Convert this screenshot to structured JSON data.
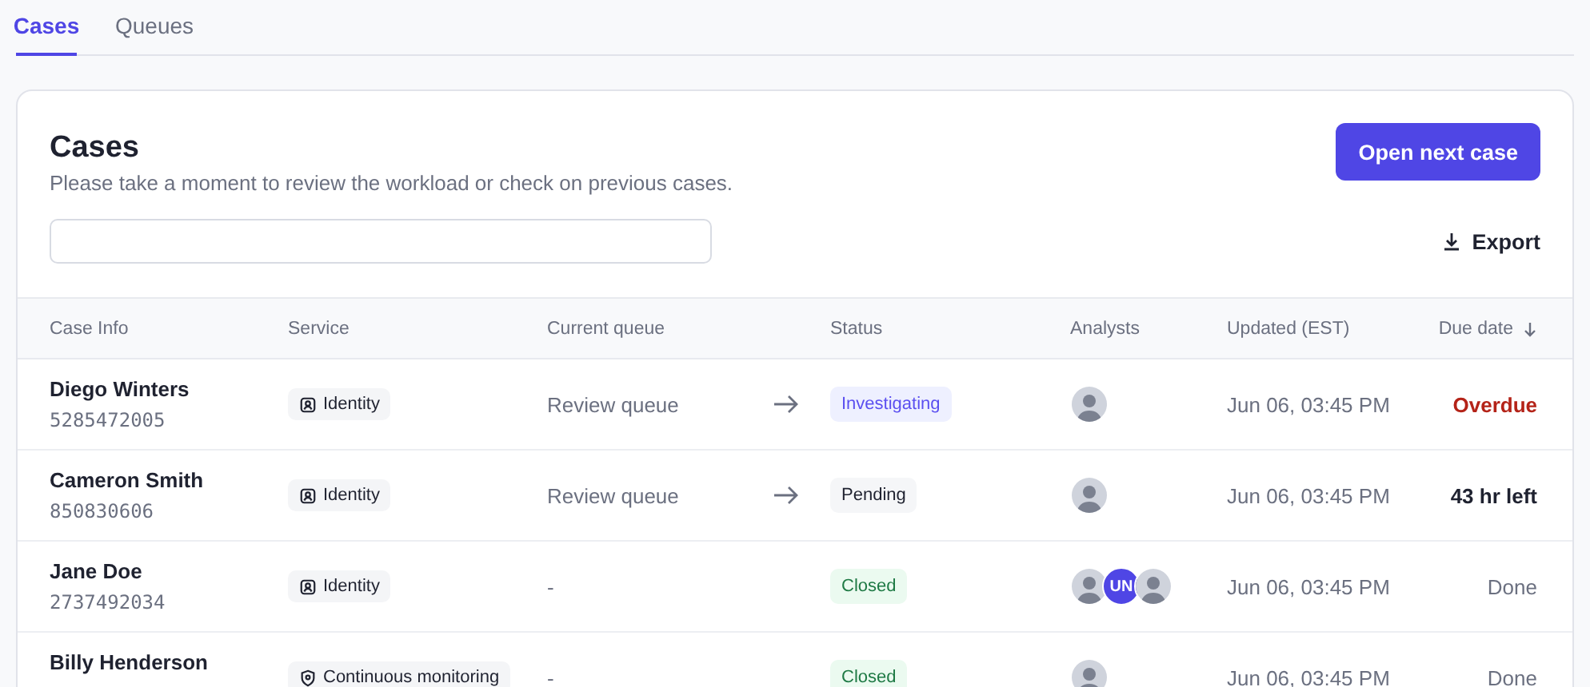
{
  "tabs": [
    {
      "label": "Cases",
      "selected": true
    },
    {
      "label": "Queues",
      "selected": false
    }
  ],
  "header": {
    "title": "Cases",
    "subtitle": "Please take a moment to review the workload or check on previous cases.",
    "primary_button": "Open next case",
    "export_button": "Export"
  },
  "table": {
    "columns": [
      "Case Info",
      "Service",
      "Current queue",
      "",
      "Status",
      "Analysts",
      "Updated (EST)",
      "Due date"
    ],
    "rows": [
      {
        "name": "Diego Winters",
        "id": "5285472005",
        "service": {
          "kind": "identity",
          "label": "Identity"
        },
        "queue": "Review queue",
        "has_arrow": true,
        "status": {
          "kind": "investigating",
          "label": "Investigating"
        },
        "analysts": [
          {
            "kind": "photo"
          }
        ],
        "updated": "Jun 06, 03:45 PM",
        "due": {
          "kind": "overdue",
          "label": "Overdue"
        }
      },
      {
        "name": "Cameron Smith",
        "id": "850830606",
        "service": {
          "kind": "identity",
          "label": "Identity"
        },
        "queue": "Review queue",
        "has_arrow": true,
        "status": {
          "kind": "pending",
          "label": "Pending"
        },
        "analysts": [
          {
            "kind": "photo"
          }
        ],
        "updated": "Jun 06, 03:45 PM",
        "due": {
          "kind": "remaining",
          "label": "43 hr left"
        }
      },
      {
        "name": "Jane Doe",
        "id": "2737492034",
        "service": {
          "kind": "identity",
          "label": "Identity"
        },
        "queue": "-",
        "has_arrow": false,
        "status": {
          "kind": "closed",
          "label": "Closed"
        },
        "analysts": [
          {
            "kind": "photo"
          },
          {
            "kind": "initials",
            "label": "UN"
          },
          {
            "kind": "photo"
          }
        ],
        "updated": "Jun 06, 03:45 PM",
        "due": {
          "kind": "done",
          "label": "Done"
        }
      },
      {
        "name": "Billy Henderson",
        "service": {
          "kind": "monitoring",
          "label": "Continuous monitoring"
        },
        "queue": "-",
        "has_arrow": false,
        "status": {
          "kind": "closed",
          "label": "Closed"
        },
        "analysts": [
          {
            "kind": "photo"
          }
        ],
        "updated": "Jun 06, 03:45 PM",
        "due": {
          "kind": "done",
          "label": "Done"
        }
      }
    ]
  }
}
